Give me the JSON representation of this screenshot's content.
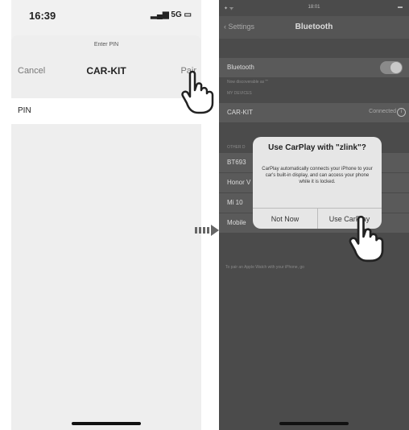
{
  "left_phone": {
    "time": "16:39",
    "signal": "5G",
    "sheet_title": "Enter PIN",
    "cancel": "Cancel",
    "device_name": "CAR-KIT",
    "pair": "Pair",
    "pin_label": "PIN"
  },
  "right_phone": {
    "status_time": "18:01",
    "back_label": "Settings",
    "title": "Bluetooth",
    "bluetooth_label": "Bluetooth",
    "discoverable_note": "Now discoverable as \"\"",
    "my_devices_header": "MY DEVICES",
    "my_device": "CAR-KIT",
    "my_device_status": "Connected",
    "other_devices_header": "OTHER D",
    "other_devices": [
      "BT693",
      "Honor V",
      "Mi 10",
      "Mobile"
    ],
    "footer": "To pair an Apple Watch with your iPhone, go",
    "alert": {
      "title": "Use CarPlay with \"zlink\"?",
      "message": "CarPlay automatically connects your iPhone to your car's built-in display, and can access your phone while it is locked.",
      "btn_not_now": "Not Now",
      "btn_use": "Use CarPlay"
    }
  }
}
